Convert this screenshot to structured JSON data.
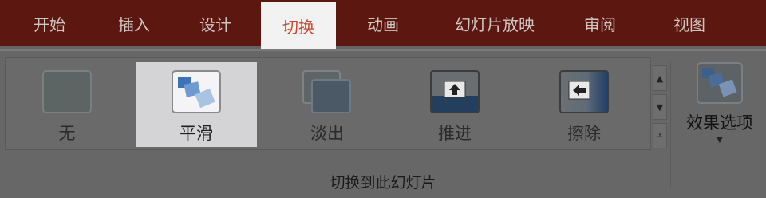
{
  "tabs": [
    {
      "label": "开始"
    },
    {
      "label": "插入"
    },
    {
      "label": "设计"
    },
    {
      "label": "切换",
      "active": true
    },
    {
      "label": "动画"
    },
    {
      "label": "幻灯片放映"
    },
    {
      "label": "审阅"
    },
    {
      "label": "视图"
    }
  ],
  "transitions": [
    {
      "label": "无",
      "icon": "none-transition-icon"
    },
    {
      "label": "平滑",
      "icon": "morph-transition-icon",
      "selected": true
    },
    {
      "label": "淡出",
      "icon": "fade-transition-icon"
    },
    {
      "label": "推进",
      "icon": "push-transition-icon"
    },
    {
      "label": "擦除",
      "icon": "wipe-transition-icon"
    }
  ],
  "effect_options": {
    "label": "效果选项",
    "icon": "effect-options-icon"
  },
  "group_label": "切换到此幻灯片",
  "colors": {
    "tabbar": "#5c1810",
    "active_tab_text": "#c8482b",
    "ribbon": "#676767",
    "selected": "#d4d3d5"
  }
}
